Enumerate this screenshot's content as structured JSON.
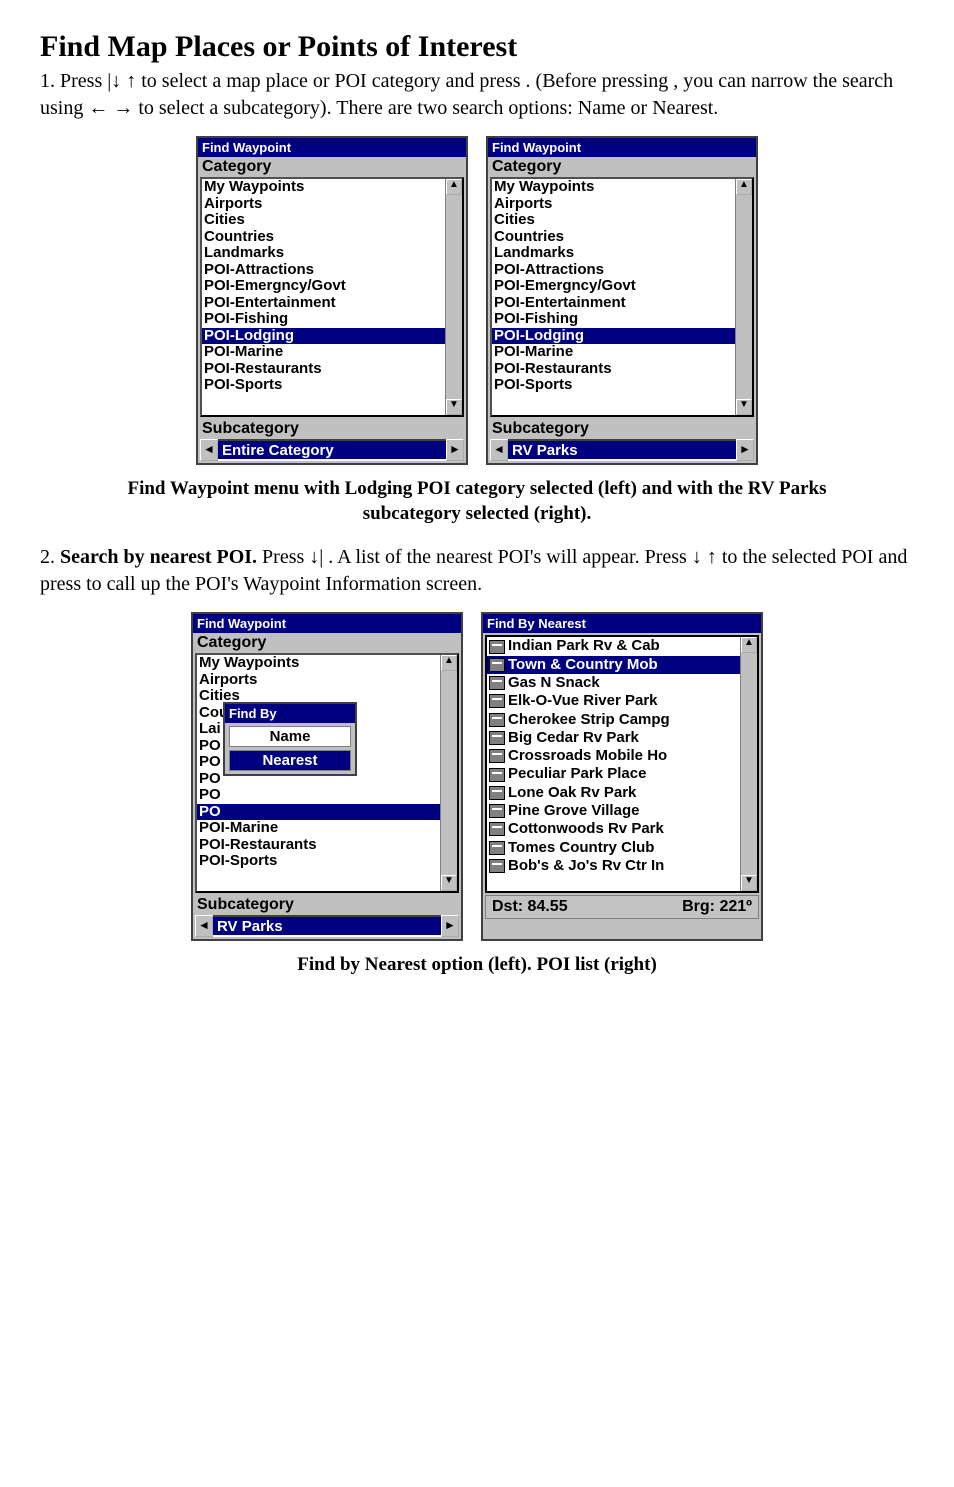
{
  "heading": "Find Map Places or Points of Interest",
  "para1_a": "1. Press ",
  "para1_b": "|↓ ↑ to select a map place or POI category and press     . (Before pressing    , you can narrow the search using ← → to select a subcategory). There are two search options: Name or Nearest.",
  "screensA": {
    "title": "Find Waypoint",
    "categoryLabel": "Category",
    "subcategoryLabel": "Subcategory",
    "items": [
      "My Waypoints",
      "Airports",
      "Cities",
      "Countries",
      "Landmarks",
      "POI-Attractions",
      "POI-Emergncy/Govt",
      "POI-Entertainment",
      "POI-Fishing",
      "POI-Lodging",
      "POI-Marine",
      "POI-Restaurants",
      "POI-Sports"
    ],
    "selectedIndex": 9,
    "left_sub": "Entire Category",
    "right_sub": "RV Parks"
  },
  "caption1": "Find Waypoint menu with Lodging POI category selected (left) and with the RV Parks subcategory selected (right).",
  "para2_prefix": "2. ",
  "para2_bold": "Search by nearest POI.",
  "para2_rest": " Press ↓|    . A list of the nearest POI's will appear. Press ↓ ↑ to the selected POI and press      to call up the POI's Waypoint Information screen.",
  "screensB": {
    "left": {
      "title": "Find Waypoint",
      "categoryLabel": "Category",
      "subcategoryLabel": "Subcategory",
      "itemsTop": [
        "My Waypoints",
        "Airports",
        "Cities",
        "Countries"
      ],
      "truncated": "Lai",
      "poMarkers": [
        "PO",
        "PO",
        "PO",
        "PO",
        "PO"
      ],
      "popupTitle": "Find By",
      "popupOptions": [
        "Name",
        "Nearest"
      ],
      "popupSelectedIndex": 1,
      "itemsBottom": [
        "POI-Marine",
        "POI-Restaurants",
        "POI-Sports"
      ],
      "sub": "RV Parks"
    },
    "right": {
      "title": "Find By Nearest",
      "items": [
        "Indian Park Rv & Cab",
        "Town & Country Mob",
        "Gas N Snack",
        "Elk-O-Vue River Park",
        "Cherokee Strip Campg",
        "Big Cedar Rv Park",
        "Crossroads Mobile Ho",
        "Peculiar Park Place",
        "Lone Oak Rv Park",
        "Pine Grove Village",
        "Cottonwoods Rv Park",
        "Tomes Country Club",
        "Bob's & Jo's Rv Ctr In"
      ],
      "selectedIndex": 1,
      "dstLabel": "Dst: 84.55",
      "brgLabel": "Brg: 221º"
    }
  },
  "caption2": "Find by Nearest option (left). POI list (right)"
}
